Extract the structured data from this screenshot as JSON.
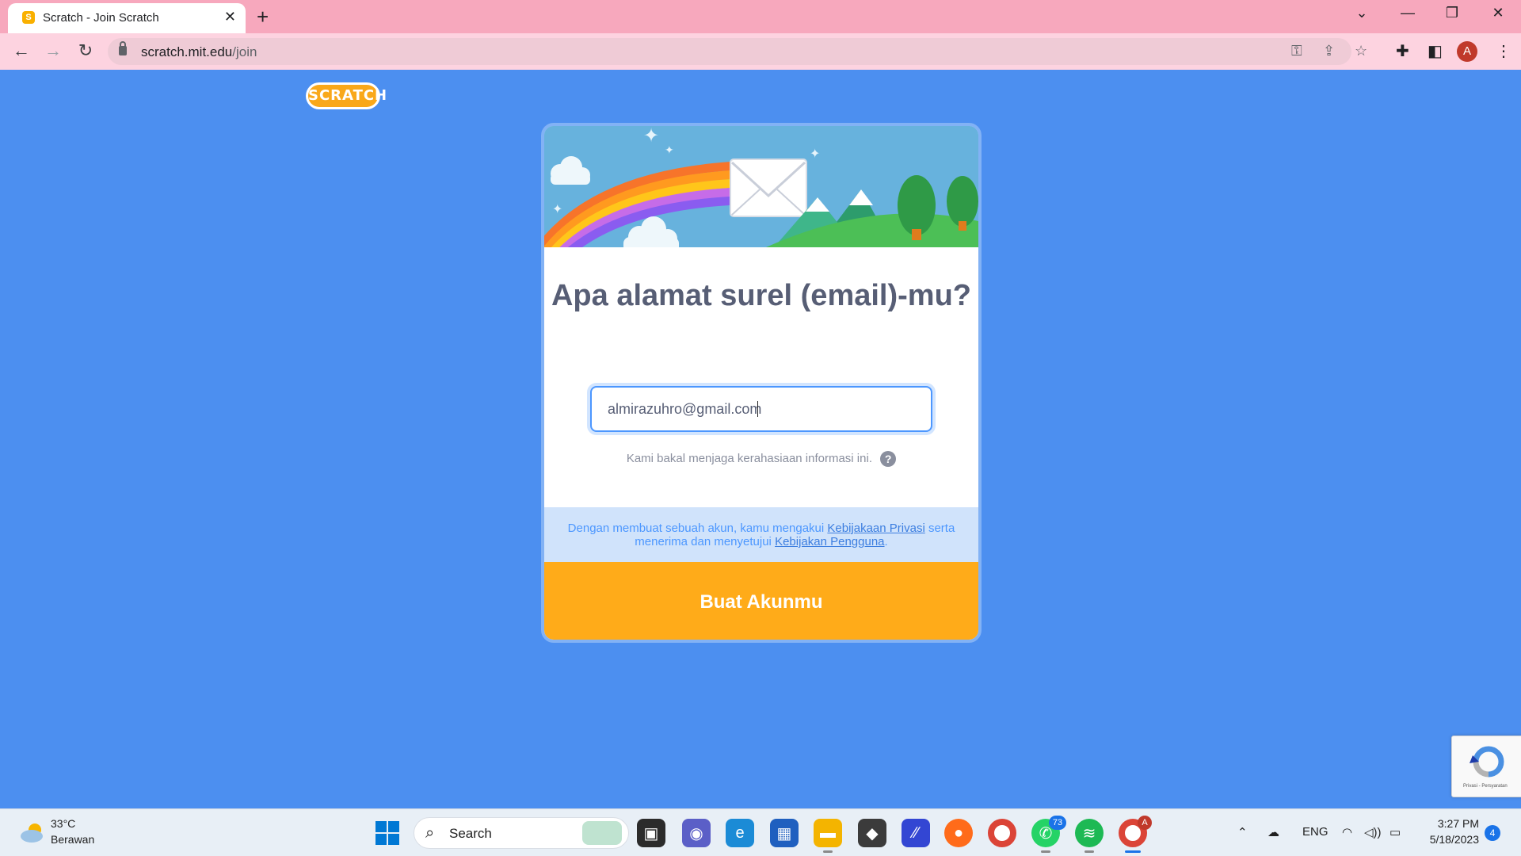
{
  "browser": {
    "tab_title": "Scratch - Join Scratch",
    "tab_favicon": "S",
    "url_host": "scratch.mit.edu",
    "url_path": "/join",
    "profile_initial": "A"
  },
  "page": {
    "logo_text": "SCRATCH",
    "heading": "Apa alamat surel (email)-mu?",
    "email_value": "almirazuhro@gmail.com",
    "privacy_hint": "Kami bakal menjaga kerahasiaan informasi ini.",
    "help_symbol": "?",
    "terms_prefix": "Dengan membuat sebuah akun, kamu mengakui",
    "terms_privacy_link": "Kebijakaan Privasi",
    "terms_middle": "serta menerima dan menyetujui",
    "terms_user_link": "Kebijakan Pengguna",
    "terms_suffix": ".",
    "submit_label": "Buat Akunmu",
    "recaptcha_text": "Privasi - Persyaratan"
  },
  "taskbar": {
    "weather_temp": "33°C",
    "weather_desc": "Berawan",
    "search_label": "Search",
    "whatsapp_badge": "73",
    "chrome_badge": "A",
    "language": "ENG",
    "time": "3:27 PM",
    "date": "5/18/2023",
    "notifications": "4"
  },
  "colors": {
    "page_bg": "#4c8ff0",
    "accent_orange": "#ffab19",
    "input_focus": "#4c97ff",
    "heading_text": "#575e75"
  }
}
